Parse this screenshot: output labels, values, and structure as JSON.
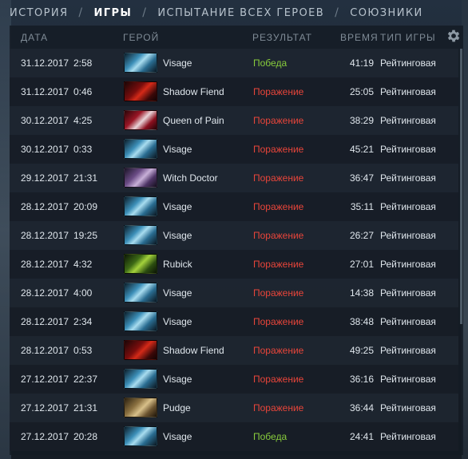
{
  "tabs": [
    "ИСТОРИЯ",
    "ИГРЫ",
    "ИСПЫТАНИЕ ВСЕХ ГЕРОЕВ",
    "СОЮЗНИКИ"
  ],
  "tab_separator": "/",
  "active_tab": "ИГРЫ",
  "columns": {
    "date": "ДАТА",
    "hero": "ГЕРОЙ",
    "result": "РЕЗУЛЬТАТ",
    "duration": "ВРЕМЯ",
    "type": "ТИП ИГРЫ"
  },
  "settings_icon": "gear-icon",
  "colors": {
    "win": "#88cc3c",
    "loss": "#e8453a"
  },
  "matches": [
    {
      "date": "31.12.2017",
      "time": "2:58",
      "hero": "Visage",
      "result": "Победа",
      "outcome": "win",
      "duration": "41:19",
      "type": "Рейтинговая"
    },
    {
      "date": "31.12.2017",
      "time": "0:46",
      "hero": "Shadow Fiend",
      "result": "Поражение",
      "outcome": "loss",
      "duration": "25:05",
      "type": "Рейтинговая"
    },
    {
      "date": "30.12.2017",
      "time": "4:25",
      "hero": "Queen of Pain",
      "result": "Поражение",
      "outcome": "loss",
      "duration": "38:29",
      "type": "Рейтинговая"
    },
    {
      "date": "30.12.2017",
      "time": "0:33",
      "hero": "Visage",
      "result": "Поражение",
      "outcome": "loss",
      "duration": "45:21",
      "type": "Рейтинговая"
    },
    {
      "date": "29.12.2017",
      "time": "21:31",
      "hero": "Witch Doctor",
      "result": "Поражение",
      "outcome": "loss",
      "duration": "36:47",
      "type": "Рейтинговая"
    },
    {
      "date": "28.12.2017",
      "time": "20:09",
      "hero": "Visage",
      "result": "Поражение",
      "outcome": "loss",
      "duration": "35:11",
      "type": "Рейтинговая"
    },
    {
      "date": "28.12.2017",
      "time": "19:25",
      "hero": "Visage",
      "result": "Поражение",
      "outcome": "loss",
      "duration": "26:27",
      "type": "Рейтинговая"
    },
    {
      "date": "28.12.2017",
      "time": "4:32",
      "hero": "Rubick",
      "result": "Поражение",
      "outcome": "loss",
      "duration": "27:01",
      "type": "Рейтинговая"
    },
    {
      "date": "28.12.2017",
      "time": "4:00",
      "hero": "Visage",
      "result": "Поражение",
      "outcome": "loss",
      "duration": "14:38",
      "type": "Рейтинговая"
    },
    {
      "date": "28.12.2017",
      "time": "2:34",
      "hero": "Visage",
      "result": "Поражение",
      "outcome": "loss",
      "duration": "38:48",
      "type": "Рейтинговая"
    },
    {
      "date": "28.12.2017",
      "time": "0:53",
      "hero": "Shadow Fiend",
      "result": "Поражение",
      "outcome": "loss",
      "duration": "49:25",
      "type": "Рейтинговая"
    },
    {
      "date": "27.12.2017",
      "time": "22:37",
      "hero": "Visage",
      "result": "Поражение",
      "outcome": "loss",
      "duration": "36:16",
      "type": "Рейтинговая"
    },
    {
      "date": "27.12.2017",
      "time": "21:31",
      "hero": "Pudge",
      "result": "Поражение",
      "outcome": "loss",
      "duration": "36:44",
      "type": "Рейтинговая"
    },
    {
      "date": "27.12.2017",
      "time": "20:28",
      "hero": "Visage",
      "result": "Победа",
      "outcome": "win",
      "duration": "24:41",
      "type": "Рейтинговая"
    }
  ]
}
